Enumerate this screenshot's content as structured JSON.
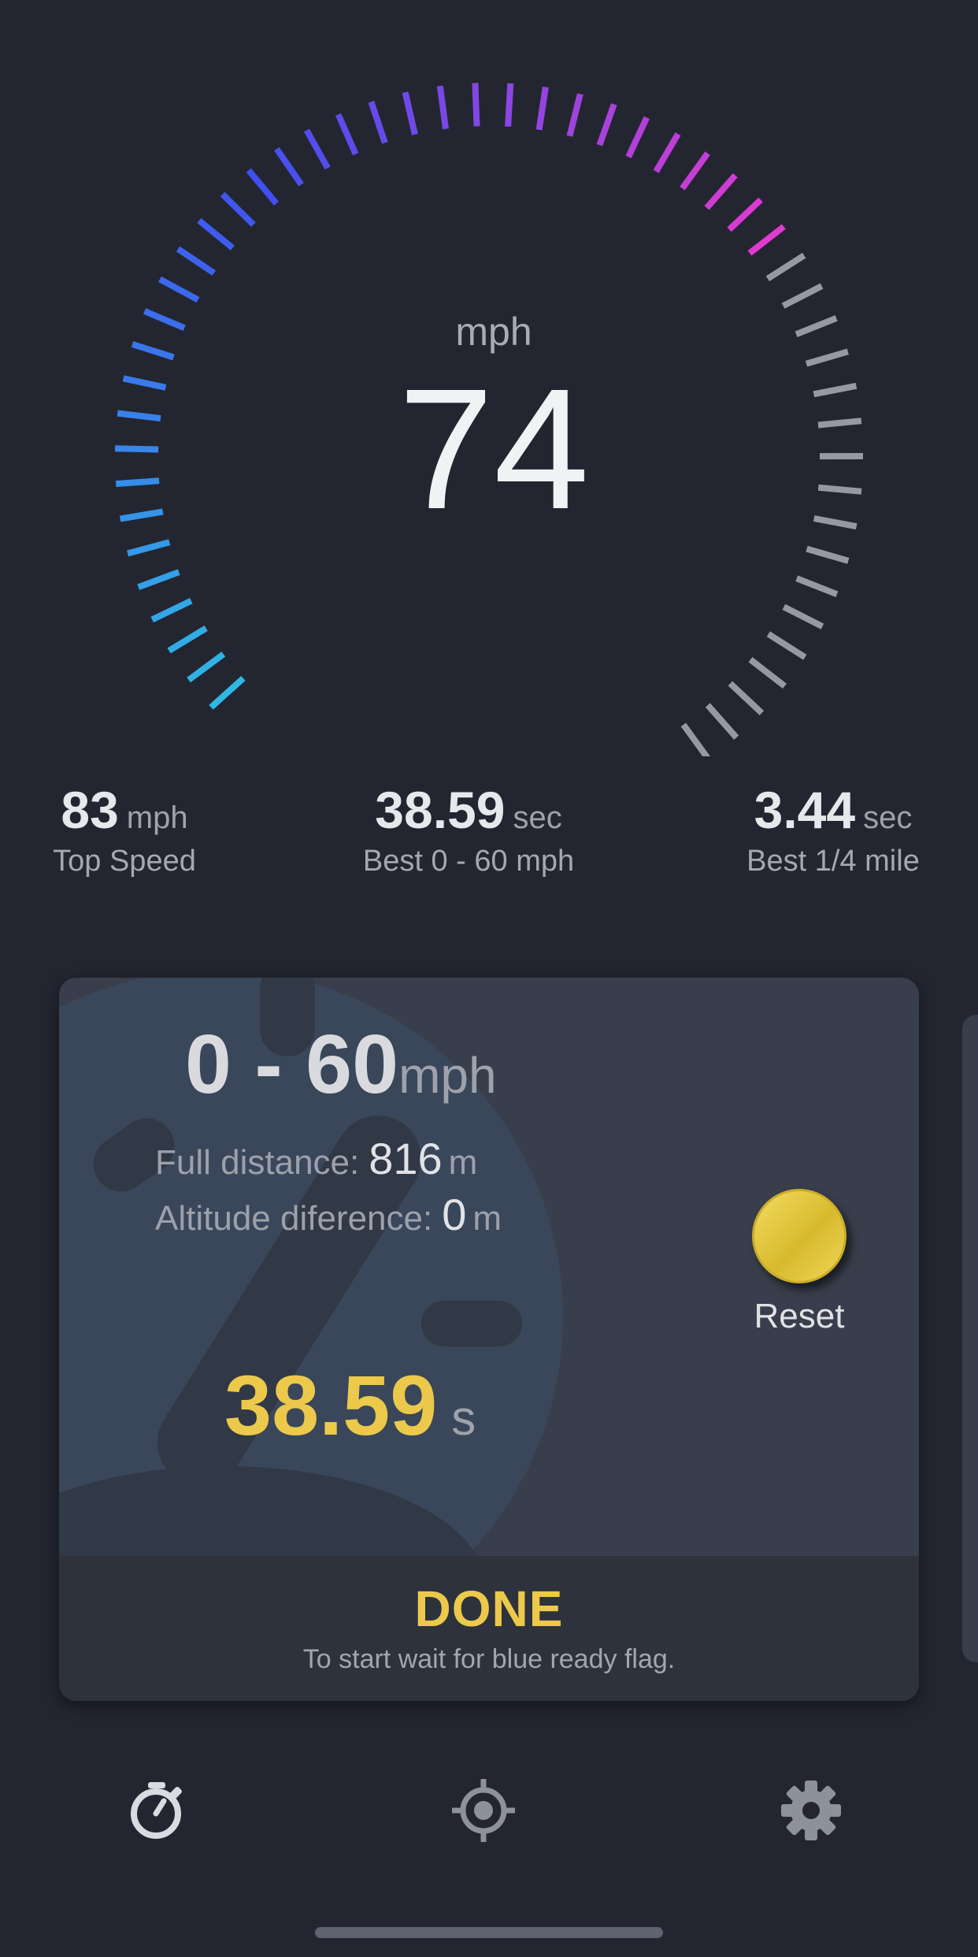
{
  "speedometer": {
    "unit": "mph",
    "speed": "74",
    "arc_colors": {
      "start": "#2fb8e4",
      "mid": "#4050f0",
      "end": "#e23ad0",
      "inactive": "#9699a3"
    },
    "ticks_active": 35,
    "ticks_total": 52
  },
  "stats": [
    {
      "value": "83",
      "unit": "mph",
      "label": "Top Speed"
    },
    {
      "value": "38.59",
      "unit": "sec",
      "label": "Best 0 - 60 mph"
    },
    {
      "value": "3.44",
      "unit": "sec",
      "label": "Best 1/4 mile"
    }
  ],
  "card": {
    "title": "0 - 60",
    "title_unit": "mph",
    "distance_label": "Full distance:",
    "distance_value": "816",
    "distance_unit": "m",
    "altitude_label": "Altitude diference:",
    "altitude_value": "0",
    "altitude_unit": "m",
    "result_value": "38.59",
    "result_unit": "s",
    "reset_label": "Reset",
    "status": "DONE",
    "hint": "To start wait for blue ready flag."
  },
  "nav": [
    {
      "icon": "stopwatch-icon"
    },
    {
      "icon": "crosshair-icon"
    },
    {
      "icon": "gear-icon"
    }
  ],
  "accent_color": "#ecc94b",
  "background_color": "#232631"
}
